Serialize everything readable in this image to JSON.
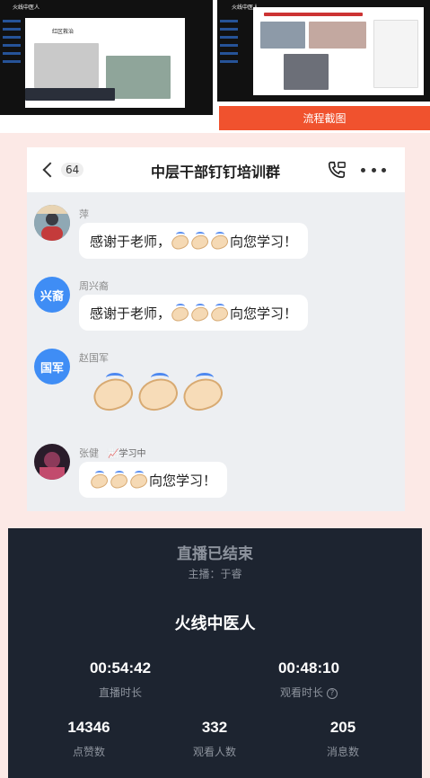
{
  "top_strip": {
    "shot1": {
      "header": "火线中医人",
      "slide_title": "红区救治"
    },
    "shot2": {
      "header": "火线中医人"
    },
    "ribbon_label": "流程截图"
  },
  "chat": {
    "back_count": "64",
    "title": "中层干部钉钉培训群",
    "messages": [
      {
        "sender": "萍",
        "text": "感谢于老师，",
        "claps": 3,
        "suffix": "向您学习！"
      },
      {
        "sender": "周兴裔",
        "avatar_text": "兴裔",
        "text": "感谢于老师，",
        "claps": 3,
        "suffix": "向您学习！"
      },
      {
        "sender": "赵国军",
        "avatar_text": "国军",
        "big_claps": 3
      },
      {
        "sender": "张健",
        "status": "📈学习中",
        "text": "",
        "claps": 3,
        "suffix": "向您学习！"
      }
    ],
    "colors": {
      "avatar": "#3f8df5",
      "background": "#edeff2"
    }
  },
  "live": {
    "title": "直播已结束",
    "host": "主播：于睿",
    "name": "火线中医人",
    "live_duration": {
      "value": "00:54:42",
      "label": "直播时长"
    },
    "watch_duration": {
      "value": "00:48:10",
      "label": "观看时长"
    },
    "likes": {
      "value": "14346",
      "label": "点赞数"
    },
    "viewers": {
      "value": "332",
      "label": "观看人数"
    },
    "messages": {
      "value": "205",
      "label": "消息数"
    },
    "colors": {
      "background": "#1d2430"
    }
  }
}
